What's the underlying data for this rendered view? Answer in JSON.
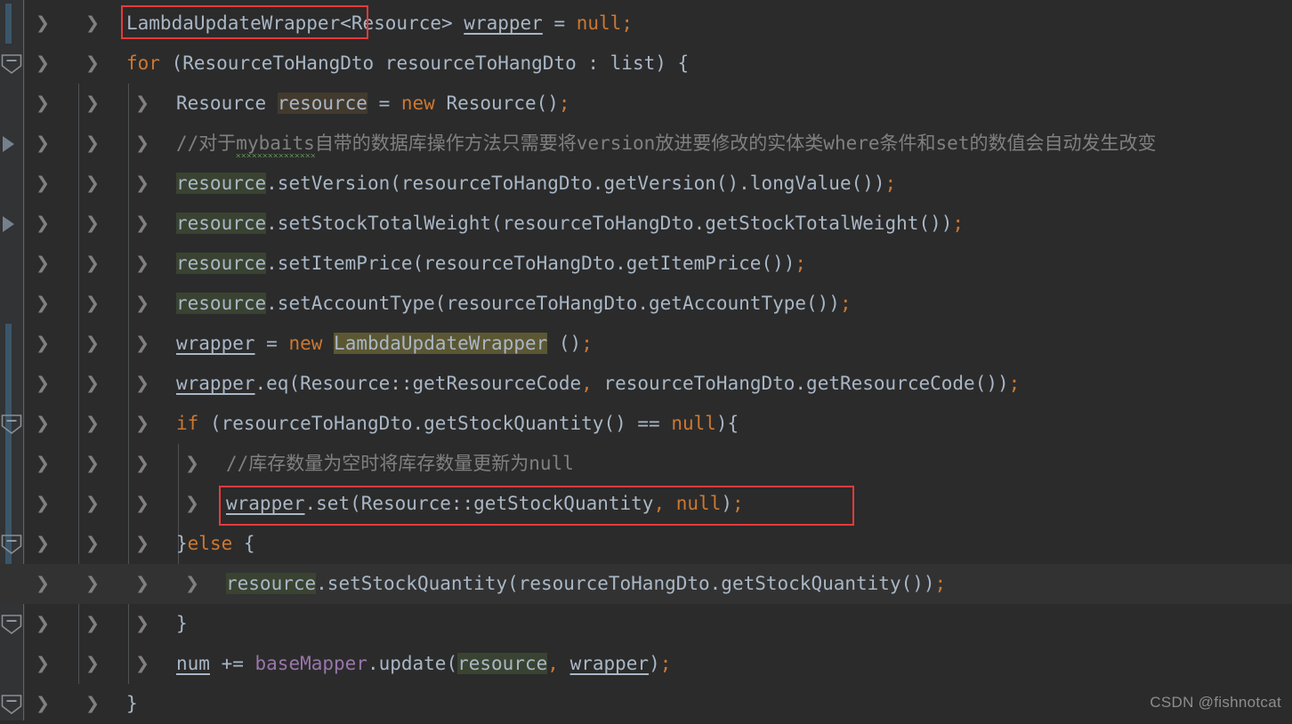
{
  "editor": {
    "background": "#2b2b2b",
    "gutter_background": "#313335",
    "current_line_background": "#323232",
    "font_size_px": 21,
    "line_height_px": 45
  },
  "watermark": {
    "text": "CSDN @fishnotcat"
  },
  "annotations": {
    "red_boxes": [
      {
        "name": "lambda-update-wrapper-declaration",
        "target": "LambdaUpdateWrapper",
        "line": 1,
        "color": "#e8393b"
      },
      {
        "name": "wrapper-set-null-statement",
        "target": "wrapper.set(Resource::getStockQuantity, null);",
        "line": 13,
        "color": "#e8393b"
      }
    ]
  },
  "gutter": {
    "fold_markers": [
      2,
      11,
      14,
      16,
      18
    ],
    "run_arrows": [
      4,
      6
    ],
    "change_markers": [
      {
        "from_line": 1,
        "to_line": 1
      },
      {
        "from_line": 9,
        "to_line": 15
      }
    ],
    "intention_bulb": {
      "line": 15,
      "icon": "lightbulb-icon",
      "color": "#f5a623"
    }
  },
  "code": {
    "language": "Java",
    "current_line": 15,
    "lines": [
      {
        "n": 1,
        "indent": 1,
        "text": "LambdaUpdateWrapper<Resource> wrapper = null;",
        "tokens": [
          {
            "t": "LambdaUpdateWrapper",
            "c": "t-class"
          },
          {
            "t": "<Resource> ",
            "c": "t-def"
          },
          {
            "t": "wrapper",
            "c": "t-local"
          },
          {
            "t": " = ",
            "c": "t-def"
          },
          {
            "t": "null",
            "c": "t-kw"
          },
          {
            "t": ";",
            "c": "t-semi"
          }
        ]
      },
      {
        "n": 2,
        "indent": 1,
        "text": "for (ResourceToHangDto resourceToHangDto : list) {",
        "tokens": [
          {
            "t": "for",
            "c": "t-kw"
          },
          {
            "t": " (ResourceToHangDto resourceToHangDto : list) {",
            "c": "t-def"
          }
        ]
      },
      {
        "n": 3,
        "indent": 2,
        "text": "Resource resource = new Resource();",
        "tokens": [
          {
            "t": "Resource ",
            "c": "t-def"
          },
          {
            "t": "resource",
            "c": "t-def hl-brown"
          },
          {
            "t": " = ",
            "c": "t-def"
          },
          {
            "t": "new",
            "c": "t-kw"
          },
          {
            "t": " Resource()",
            "c": "t-def"
          },
          {
            "t": ";",
            "c": "t-semi"
          }
        ]
      },
      {
        "n": 4,
        "indent": 2,
        "text": "//对于mybaits自带的数据库操作方法只需要将version放进要修改的实体类where条件和set的数值会自动发生改变",
        "tokens": [
          {
            "t": "//对于",
            "c": "t-comment"
          },
          {
            "t": "mybaits",
            "c": "t-comment typo"
          },
          {
            "t": "自带的数据库操作方法只需要将version放进要修改的实体类where条件和set的数值会自动发生改变",
            "c": "t-comment"
          }
        ]
      },
      {
        "n": 5,
        "indent": 2,
        "text": "resource.setVersion(resourceToHangDto.getVersion().longValue());",
        "tokens": [
          {
            "t": "resource",
            "c": "t-def hl-green"
          },
          {
            "t": ".setVersion(resourceToHangDto.getVersion().longValue())",
            "c": "t-def"
          },
          {
            "t": ";",
            "c": "t-semi"
          }
        ]
      },
      {
        "n": 6,
        "indent": 2,
        "text": "resource.setStockTotalWeight(resourceToHangDto.getStockTotalWeight());",
        "tokens": [
          {
            "t": "resource",
            "c": "t-def hl-green"
          },
          {
            "t": ".setStockTotalWeight(resourceToHangDto.getStockTotalWeight())",
            "c": "t-def"
          },
          {
            "t": ";",
            "c": "t-semi"
          }
        ]
      },
      {
        "n": 7,
        "indent": 2,
        "text": "resource.setItemPrice(resourceToHangDto.getItemPrice());",
        "tokens": [
          {
            "t": "resource",
            "c": "t-def hl-green"
          },
          {
            "t": ".setItemPrice(resourceToHangDto.getItemPrice())",
            "c": "t-def"
          },
          {
            "t": ";",
            "c": "t-semi"
          }
        ]
      },
      {
        "n": 8,
        "indent": 2,
        "text": "resource.setAccountType(resourceToHangDto.getAccountType());",
        "tokens": [
          {
            "t": "resource",
            "c": "t-def hl-green"
          },
          {
            "t": ".setAccountType(resourceToHangDto.getAccountType())",
            "c": "t-def"
          },
          {
            "t": ";",
            "c": "t-semi"
          }
        ]
      },
      {
        "n": 9,
        "indent": 2,
        "text": "wrapper = new LambdaUpdateWrapper ();",
        "tokens": [
          {
            "t": "wrapper",
            "c": "t-local"
          },
          {
            "t": " = ",
            "c": "t-def"
          },
          {
            "t": "new",
            "c": "t-kw"
          },
          {
            "t": " ",
            "c": "t-def"
          },
          {
            "t": "LambdaUpdateWrapper",
            "c": "t-def hl-olive"
          },
          {
            "t": " ()",
            "c": "t-def"
          },
          {
            "t": ";",
            "c": "t-semi"
          }
        ]
      },
      {
        "n": 10,
        "indent": 2,
        "text": "wrapper.eq(Resource::getResourceCode, resourceToHangDto.getResourceCode());",
        "tokens": [
          {
            "t": "wrapper",
            "c": "t-local"
          },
          {
            "t": ".eq(Resource::getResourceCode",
            "c": "t-def"
          },
          {
            "t": ",",
            "c": "t-semi"
          },
          {
            "t": " resourceToHangDto.getResourceCode())",
            "c": "t-def"
          },
          {
            "t": ";",
            "c": "t-semi"
          }
        ]
      },
      {
        "n": 11,
        "indent": 2,
        "text": "if (resourceToHangDto.getStockQuantity() == null){",
        "tokens": [
          {
            "t": "if",
            "c": "t-kw"
          },
          {
            "t": " (resourceToHangDto.getStockQuantity() == ",
            "c": "t-def"
          },
          {
            "t": "null",
            "c": "t-kw"
          },
          {
            "t": "){",
            "c": "t-def"
          }
        ]
      },
      {
        "n": 12,
        "indent": 3,
        "text": "//库存数量为空时将库存数量更新为null",
        "tokens": [
          {
            "t": "//库存数量为空时将库存数量更新为null",
            "c": "t-comment"
          }
        ]
      },
      {
        "n": 13,
        "indent": 3,
        "text": "wrapper.set(Resource::getStockQuantity, null);",
        "tokens": [
          {
            "t": "wrapper",
            "c": "t-local"
          },
          {
            "t": ".set(Resource::getStockQuantity",
            "c": "t-def"
          },
          {
            "t": ",",
            "c": "t-semi"
          },
          {
            "t": " ",
            "c": "t-def"
          },
          {
            "t": "null",
            "c": "t-kw"
          },
          {
            "t": ")",
            "c": "t-def"
          },
          {
            "t": ";",
            "c": "t-semi"
          }
        ]
      },
      {
        "n": 14,
        "indent": 2,
        "text": "}else {",
        "tokens": [
          {
            "t": "}",
            "c": "t-def"
          },
          {
            "t": "else",
            "c": "t-kw"
          },
          {
            "t": " {",
            "c": "t-def"
          }
        ]
      },
      {
        "n": 15,
        "indent": 3,
        "text": "resource.setStockQuantity(resourceToHangDto.getStockQuantity());",
        "tokens": [
          {
            "t": "resource",
            "c": "t-def hl-green"
          },
          {
            "t": ".setStockQuantity(resourceToHangDto.getStockQuantity())",
            "c": "t-def"
          },
          {
            "t": ";",
            "c": "t-semi"
          }
        ]
      },
      {
        "n": 16,
        "indent": 2,
        "text": "}",
        "tokens": [
          {
            "t": "}",
            "c": "t-def"
          }
        ]
      },
      {
        "n": 17,
        "indent": 2,
        "text": "num += baseMapper.update(resource, wrapper);",
        "tokens": [
          {
            "t": "num",
            "c": "t-local"
          },
          {
            "t": " += ",
            "c": "t-def"
          },
          {
            "t": "baseMapper",
            "c": "t-field"
          },
          {
            "t": ".update(",
            "c": "t-def"
          },
          {
            "t": "resource",
            "c": "t-def hl-green"
          },
          {
            "t": ",",
            "c": "t-semi"
          },
          {
            "t": " ",
            "c": "t-def"
          },
          {
            "t": "wrapper",
            "c": "t-local"
          },
          {
            "t": ")",
            "c": "t-def"
          },
          {
            "t": ";",
            "c": "t-semi"
          }
        ]
      },
      {
        "n": 18,
        "indent": 1,
        "text": "}",
        "tokens": [
          {
            "t": "}",
            "c": "t-def"
          }
        ]
      }
    ]
  }
}
